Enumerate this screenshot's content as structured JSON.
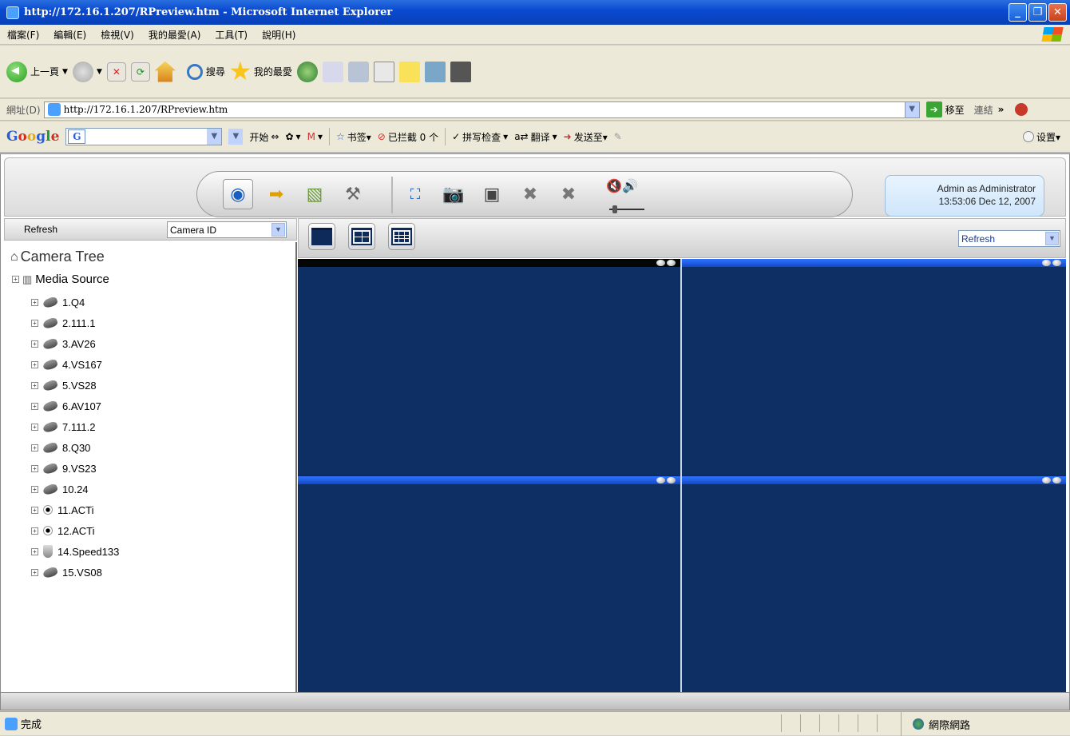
{
  "window": {
    "title": "http://172.16.1.207/RPreview.htm - Microsoft Internet Explorer",
    "minimize_glyph": "_",
    "maximize_glyph": "❐",
    "close_glyph": "✕"
  },
  "menu": [
    "檔案(F)",
    "編輯(E)",
    "檢視(V)",
    "我的最愛(A)",
    "工具(T)",
    "說明(H)"
  ],
  "toolbar": {
    "back_label": "上一頁",
    "search_label": "搜尋",
    "favorites_label": "我的最愛"
  },
  "address": {
    "label": "網址(D)",
    "url": "http://172.16.1.207/RPreview.htm",
    "go_label": "移至",
    "links_label": "連結",
    "chevron": "»"
  },
  "google_bar": {
    "start_label": "开始",
    "bookmarks_label": "书签▾",
    "blocked_label": "已拦截 0 个",
    "spellcheck_label": "拼写检查",
    "translate_label": "翻译",
    "sendto_label": "发送至▾",
    "settings_label": "设置▾"
  },
  "app": {
    "user_line1": "Admin as Administrator",
    "user_line2": "13:53:06 Dec 12, 2007",
    "left_refresh": "Refresh",
    "sort_select": "Camera ID",
    "right_refresh_select": "Refresh",
    "tree_root": "Camera Tree",
    "media_source": "Media Source",
    "cameras": [
      {
        "label": "1.Q4",
        "icon": "camera-icon"
      },
      {
        "label": "2.111.1",
        "icon": "camera-icon"
      },
      {
        "label": "3.AV26",
        "icon": "camera-icon"
      },
      {
        "label": "4.VS167",
        "icon": "camera-icon"
      },
      {
        "label": "5.VS28",
        "icon": "camera-icon"
      },
      {
        "label": "6.AV107",
        "icon": "camera-icon"
      },
      {
        "label": "7.111.2",
        "icon": "camera-icon"
      },
      {
        "label": "8.Q30",
        "icon": "camera-icon"
      },
      {
        "label": "9.VS23",
        "icon": "camera-icon"
      },
      {
        "label": "10.24",
        "icon": "camera-icon"
      },
      {
        "label": "11.ACTi",
        "icon": "acti-camera-icon"
      },
      {
        "label": "12.ACTi",
        "icon": "acti-camera-icon"
      },
      {
        "label": "14.Speed133",
        "icon": "dome-camera-icon"
      },
      {
        "label": "15.VS08",
        "icon": "camera-icon"
      }
    ]
  },
  "status": {
    "text": "完成",
    "zone": "網際網路"
  },
  "colors": {
    "video_bg": "#0e2f63",
    "tile_header": "#1248c8",
    "xp_title": "#0a4bd1"
  }
}
